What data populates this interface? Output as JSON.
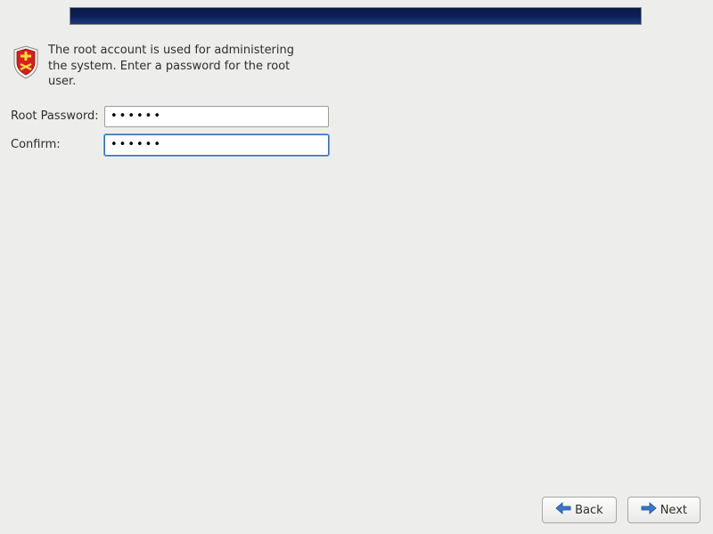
{
  "intro": "The root account is used for administering the system.  Enter a password for the root user.",
  "labels": {
    "password": "Root Password:",
    "confirm": "Confirm:"
  },
  "values": {
    "password": "••••••",
    "confirm": "••••••"
  },
  "buttons": {
    "back": "Back",
    "next": "Next"
  }
}
